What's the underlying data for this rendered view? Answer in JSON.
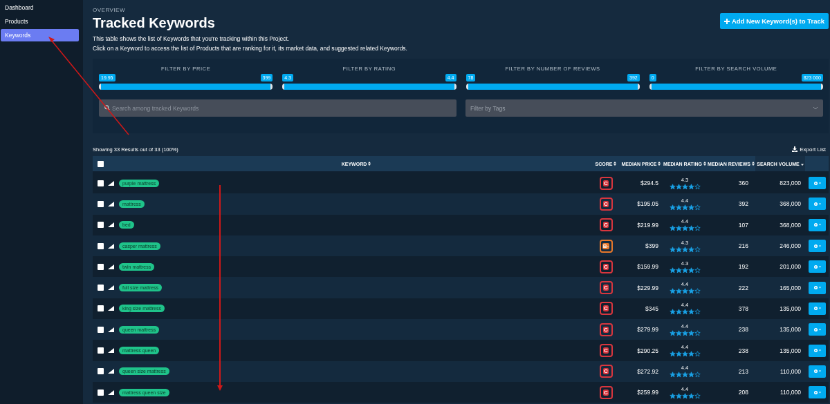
{
  "sidebar": {
    "items": [
      {
        "label": "Dashboard",
        "selected": false
      },
      {
        "label": "Products",
        "selected": false
      },
      {
        "label": "Keywords",
        "selected": true
      }
    ]
  },
  "header": {
    "eyebrow": "OVERVIEW",
    "title": "Tracked Keywords",
    "description": [
      "This table shows the list of Keywords that you're tracking within this Project.",
      "Click on a Keyword to access the list of Products that are ranking for it, its market data, and suggested related Keywords."
    ],
    "add_button": "Add New Keyword(s) to Track"
  },
  "filters": [
    {
      "title": "FILTER BY PRICE",
      "min": "19.95",
      "max": "399",
      "level": 1
    },
    {
      "title": "FILTER BY RATING",
      "min": "4.3",
      "max": "4.4",
      "level": 1
    },
    {
      "title": "FILTER BY NUMBER OF REVIEWS",
      "min": "78",
      "max": "392",
      "level": 1
    },
    {
      "title": "FILTER BY SEARCH VOLUME",
      "min": "0",
      "max": "823 000",
      "level": 1
    }
  ],
  "search": {
    "placeholder": "Search among tracked Keywords"
  },
  "tags": {
    "placeholder": "Filter by Tags"
  },
  "results": "Showing 33 Results out of 33 (100%)",
  "export": "Export List",
  "table": {
    "select_all": {
      "checked": false
    },
    "columns": [
      {
        "label": "KEYWORD",
        "sorted": false
      },
      {
        "label": "SCORE",
        "sorted": false
      },
      {
        "label": "MEDIAN PRICE",
        "sorted": false
      },
      {
        "label": "MEDIAN RATING",
        "sorted": false
      },
      {
        "label": "MEDIAN REVIEWS",
        "sorted": false
      },
      {
        "label": "SEARCH VOLUME",
        "sorted": true
      }
    ],
    "rows": [
      {
        "checked": false,
        "keyword": "purple mattress",
        "score": "C",
        "color": "#d9363e",
        "price": "$294.5",
        "rating": "4.3",
        "stars": 4,
        "reviews": "360",
        "volume": "823,000"
      },
      {
        "checked": false,
        "keyword": "mattress",
        "score": "C",
        "color": "#d9363e",
        "price": "$195.05",
        "rating": "4.4",
        "stars": 4,
        "reviews": "392",
        "volume": "368,000"
      },
      {
        "checked": false,
        "keyword": "bed",
        "score": "C",
        "color": "#d9363e",
        "price": "$219.99",
        "rating": "4.4",
        "stars": 4,
        "reviews": "107",
        "volume": "368,000"
      },
      {
        "checked": false,
        "keyword": "casper mattress",
        "score": "B-",
        "color": "#e8782a",
        "price": "$399",
        "rating": "4.3",
        "stars": 4,
        "reviews": "216",
        "volume": "246,000"
      },
      {
        "checked": false,
        "keyword": "twin mattress",
        "score": "C",
        "color": "#d9363e",
        "price": "$159.99",
        "rating": "4.3",
        "stars": 4,
        "reviews": "192",
        "volume": "201,000"
      },
      {
        "checked": false,
        "keyword": "full size mattress",
        "score": "C",
        "color": "#d9363e",
        "price": "$229.99",
        "rating": "4.4",
        "stars": 4,
        "reviews": "222",
        "volume": "165,000"
      },
      {
        "checked": false,
        "keyword": "king size mattress",
        "score": "C",
        "color": "#d9363e",
        "price": "$345",
        "rating": "4.4",
        "stars": 4,
        "reviews": "378",
        "volume": "135,000"
      },
      {
        "checked": false,
        "keyword": "queen mattress",
        "score": "C",
        "color": "#d9363e",
        "price": "$279.99",
        "rating": "4.4",
        "stars": 4,
        "reviews": "238",
        "volume": "135,000"
      },
      {
        "checked": false,
        "keyword": "mattress queen",
        "score": "C",
        "color": "#d9363e",
        "price": "$290.25",
        "rating": "4.4",
        "stars": 4,
        "reviews": "238",
        "volume": "135,000"
      },
      {
        "checked": false,
        "keyword": "queen size mattress",
        "score": "C",
        "color": "#d9363e",
        "price": "$272.92",
        "rating": "4.4",
        "stars": 4,
        "reviews": "213",
        "volume": "110,000"
      },
      {
        "checked": false,
        "keyword": "mattress queen size",
        "score": "C",
        "color": "#d9363e",
        "price": "$259.99",
        "rating": "4.4",
        "stars": 4,
        "reviews": "208",
        "volume": "110,000"
      }
    ]
  }
}
